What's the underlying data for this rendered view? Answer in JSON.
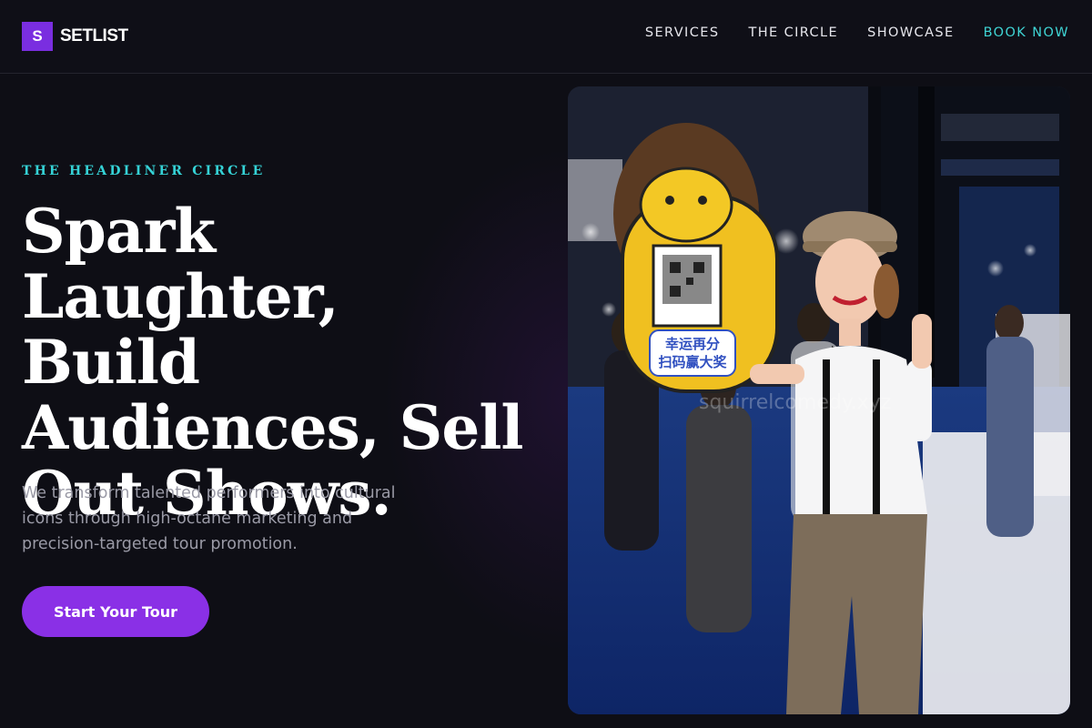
{
  "brand": {
    "mark": "S",
    "name": "SETLIST"
  },
  "nav": {
    "items": [
      "SERVICES",
      "THE CIRCLE",
      "SHOWCASE"
    ],
    "cta": "BOOK NOW"
  },
  "hero": {
    "eyebrow": "THE HEADLINER CIRCLE",
    "headline": "Spark Laughter, Build Audiences, Sell Out Shows.",
    "subtext": "We transform talented performers into cultural icons through high-octane marketing and precision-targeted tour promotion.",
    "cta_label": "Start Your Tour",
    "image": {
      "description_icon": "performer-photo",
      "sign_text_line1": "幸运再分",
      "sign_text_line2": "扫码赢大奖",
      "watermark": "squirrelcomedy.xyz"
    }
  },
  "colors": {
    "background": "#0e0e15",
    "accent_purple": "#8a30e6",
    "accent_teal": "#35d2d6",
    "nav_text": "#e6e6ec",
    "body_text": "#9a9aa6"
  }
}
